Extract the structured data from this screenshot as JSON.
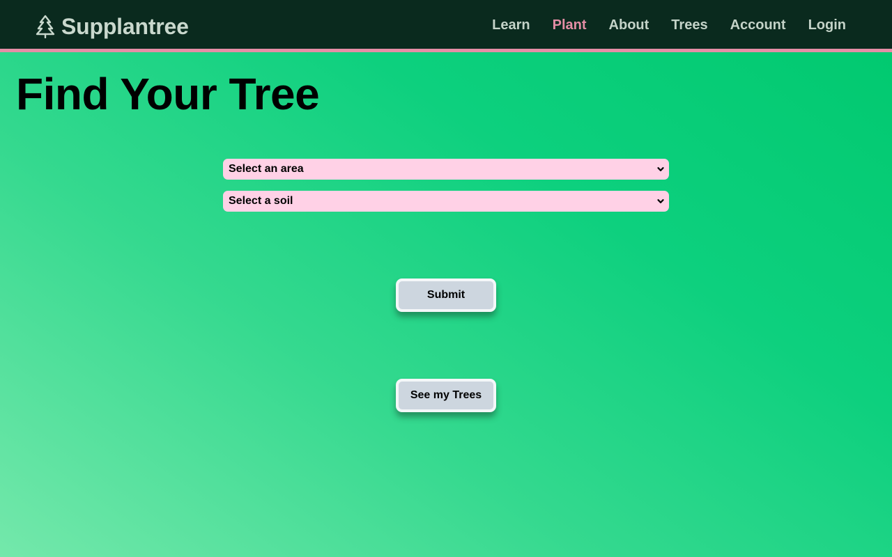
{
  "app": {
    "brand": "Supplantree",
    "brand_icon": "tree-icon"
  },
  "nav": {
    "items": [
      {
        "label": "Learn",
        "active": false
      },
      {
        "label": "Plant",
        "active": true
      },
      {
        "label": "About",
        "active": false
      },
      {
        "label": "Trees",
        "active": false
      },
      {
        "label": "Account",
        "active": false
      },
      {
        "label": "Login",
        "active": false
      }
    ],
    "active_color": "#e58ea6"
  },
  "main": {
    "title": "Find Your Tree",
    "area_select": {
      "selected": "Select an area"
    },
    "soil_select": {
      "selected": "Select a soil"
    },
    "submit_label": "Submit",
    "see_trees_label": "See my Trees"
  },
  "colors": {
    "navbar_bg": "#0a2a1e",
    "accent": "#e58ea6",
    "select_bg": "#ffd1e6",
    "button_bg": "#cdd6df",
    "gradient_start": "#74e8ab",
    "gradient_end": "#00c86e"
  }
}
